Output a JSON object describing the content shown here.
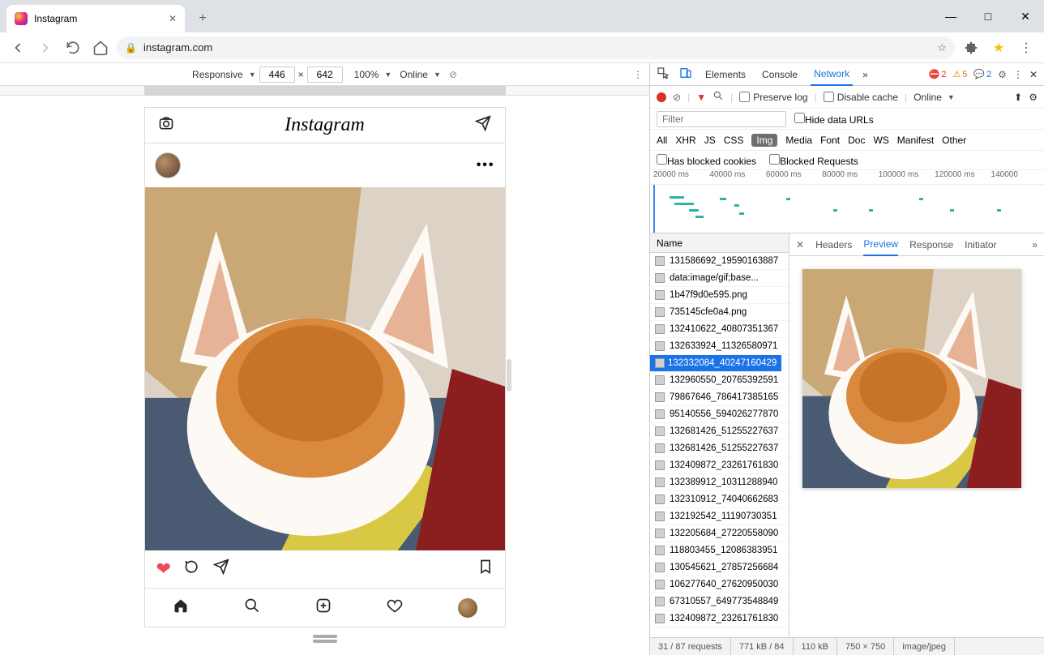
{
  "browser": {
    "tab_title": "Instagram",
    "url": "instagram.com"
  },
  "device_toolbar": {
    "mode": "Responsive",
    "width": "446",
    "height": "642",
    "zoom": "100%",
    "throttle": "Online"
  },
  "instagram": {
    "logo": "Instagram"
  },
  "devtools": {
    "tabs": [
      "Elements",
      "Console",
      "Network"
    ],
    "active_tab": "Network",
    "errors": "2",
    "warnings": "5",
    "info": "2",
    "network": {
      "preserve_log": "Preserve log",
      "disable_cache": "Disable cache",
      "throttle": "Online",
      "filter_placeholder": "Filter",
      "hide_data_urls": "Hide data URLs",
      "types": [
        "All",
        "XHR",
        "JS",
        "CSS",
        "Img",
        "Media",
        "Font",
        "Doc",
        "WS",
        "Manifest",
        "Other"
      ],
      "active_type": "Img",
      "blocked_cookies": "Has blocked cookies",
      "blocked_requests": "Blocked Requests",
      "time_ticks": [
        "20000 ms",
        "40000 ms",
        "60000 ms",
        "80000 ms",
        "100000 ms",
        "120000 ms",
        "140000"
      ],
      "name_header": "Name",
      "requests": [
        "131586692_19590163887",
        "data:image/gif;base...",
        "1b47f9d0e595.png",
        "735145cfe0a4.png",
        "132410622_40807351367",
        "132633924_11326580971",
        "132332084_40247160429",
        "132960550_20765392591",
        "79867646_786417385165",
        "95140556_594026277870",
        "132681426_51255227637",
        "132681426_51255227637",
        "132409872_23261761830",
        "132389912_10311288940",
        "132310912_74040662683",
        "132192542_11190730351",
        "132205684_27220558090",
        "118803455_12086383951",
        "130545621_27857256684",
        "106277640_27620950030",
        "67310557_649773548849",
        "132409872_23261761830"
      ],
      "selected_index": 6,
      "detail_tabs": [
        "Headers",
        "Preview",
        "Response",
        "Initiator"
      ],
      "active_detail_tab": "Preview",
      "status": {
        "reqs": "31 / 87 requests",
        "transferred": "771 kB / 84",
        "resources": "110 kB",
        "dims": "750 × 750",
        "mime": "image/jpeg"
      }
    }
  }
}
